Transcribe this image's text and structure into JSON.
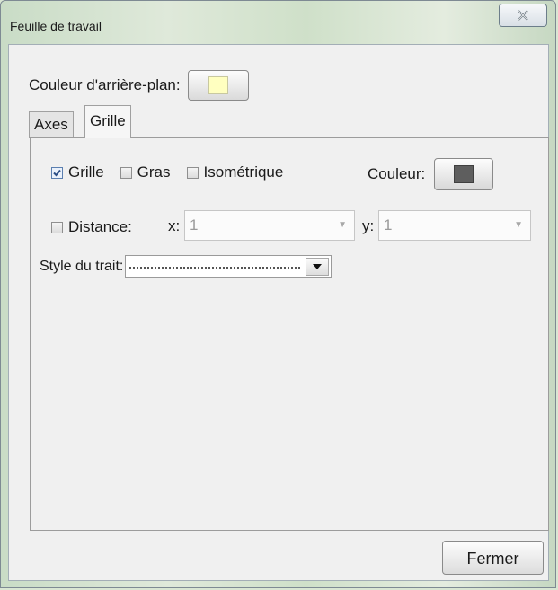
{
  "window": {
    "title": "Feuille de travail",
    "close_icon": "close-x-icon"
  },
  "background": {
    "label": "Couleur d'arrière-plan:",
    "color": "#ffffc0"
  },
  "tabs": [
    {
      "label": "Axes",
      "active": false
    },
    {
      "label": "Grille",
      "active": true
    }
  ],
  "grid": {
    "show_grid": {
      "label": "Grille",
      "checked": true
    },
    "bold": {
      "label": "Gras",
      "checked": false
    },
    "isometric": {
      "label": "Isométrique",
      "checked": false
    },
    "color_label": "Couleur:",
    "color": "#5e5e5e",
    "distance": {
      "label": "Distance:",
      "checked": false,
      "x_label": "x:",
      "x_value": "1",
      "y_label": "y:",
      "y_value": "1"
    },
    "line_style": {
      "label": "Style du trait:",
      "value": "dotted"
    }
  },
  "buttons": {
    "close": "Fermer"
  }
}
